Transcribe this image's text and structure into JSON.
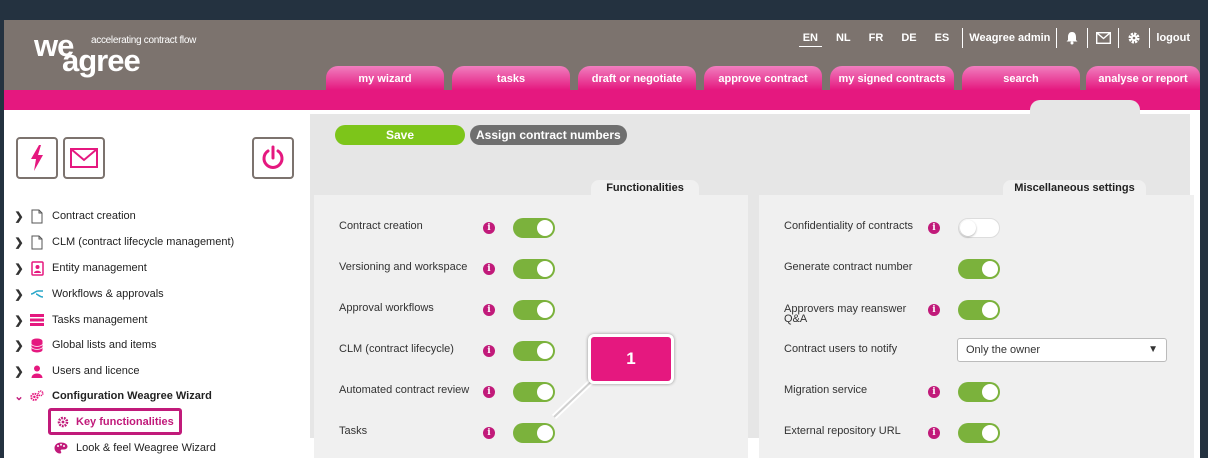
{
  "brand": {
    "we": "we",
    "agree": "agree",
    "tagline": "accelerating contract flow",
    "accent": "#e5187f",
    "header_bg": "#7c736e"
  },
  "header": {
    "languages": [
      {
        "code": "EN",
        "active": true
      },
      {
        "code": "NL",
        "active": false
      },
      {
        "code": "FR",
        "active": false
      },
      {
        "code": "DE",
        "active": false
      },
      {
        "code": "ES",
        "active": false
      }
    ],
    "user": "Weagree admin",
    "icons": [
      "bell-icon",
      "mail-icon",
      "gear-icon"
    ],
    "logout": "logout"
  },
  "tabs": [
    "my wizard",
    "tasks",
    "draft or negotiate",
    "approve contract",
    "my signed contracts",
    "search",
    "analyse or report"
  ],
  "sidebar": {
    "buttons": [
      "lightning-icon",
      "envelope-icon",
      "power-icon"
    ],
    "items": [
      {
        "label": "Contract creation",
        "icon": "document-icon"
      },
      {
        "label": "CLM (contract lifecycle management)",
        "icon": "document-icon"
      },
      {
        "label": "Entity management",
        "icon": "contact-card-icon"
      },
      {
        "label": "Workflows & approvals",
        "icon": "workflow-icon"
      },
      {
        "label": "Tasks management",
        "icon": "tasks-icon"
      },
      {
        "label": "Global lists and items",
        "icon": "database-icon"
      },
      {
        "label": "Users and licence",
        "icon": "user-icon"
      },
      {
        "label": "Configuration Weagree Wizard",
        "icon": "gears-icon",
        "expanded": true
      }
    ],
    "subitems": [
      {
        "label": "Key functionalities",
        "icon": "gear-icon",
        "active": true
      },
      {
        "label": "Look & feel Weagree Wizard",
        "icon": "palette-icon",
        "active": false
      }
    ]
  },
  "toolbar": {
    "save_label": "Save",
    "assign_label": "Assign contract numbers"
  },
  "functionalities": {
    "title": "Functionalities",
    "rows": [
      {
        "label": "Contract creation",
        "info": "i",
        "on": true
      },
      {
        "label": "Versioning and workspace",
        "info": "i",
        "on": true
      },
      {
        "label": "Approval workflows",
        "info": "i",
        "on": true
      },
      {
        "label": "CLM (contract lifecycle)",
        "info": "i",
        "on": true
      },
      {
        "label": "Automated contract review",
        "info": "i",
        "on": true
      },
      {
        "label": "Tasks",
        "info": "i",
        "on": true
      }
    ]
  },
  "misc": {
    "title": "Miscellaneous settings",
    "rows": [
      {
        "label_lines": [
          "Confidentiality of contracts"
        ],
        "info": "i",
        "control": "toggle",
        "on": false
      },
      {
        "label_lines": [
          "Generate contract number"
        ],
        "info": null,
        "control": "toggle",
        "on": true
      },
      {
        "label_lines": [
          "Approvers may reanswer",
          "Q&A"
        ],
        "info": "i",
        "control": "toggle",
        "on": true
      },
      {
        "label_lines": [
          "Contract users to notify"
        ],
        "info": null,
        "control": "select",
        "value": "Only the owner"
      },
      {
        "label_lines": [
          "Migration service"
        ],
        "info": "i",
        "control": "toggle",
        "on": true
      },
      {
        "label_lines": [
          "External repository URL"
        ],
        "info": "i",
        "control": "toggle",
        "on": true
      }
    ]
  },
  "callout": {
    "number": "1"
  }
}
